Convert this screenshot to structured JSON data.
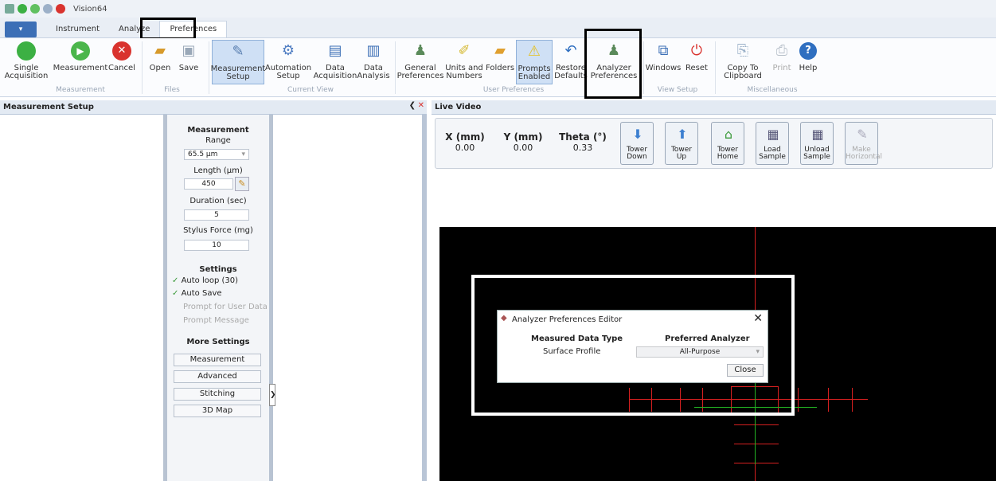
{
  "app": {
    "title": "Vision64"
  },
  "tabs": [
    "Instrument",
    "Analyze",
    "Preferences"
  ],
  "ribbon": {
    "buttons": [
      {
        "label": "Single\nAcquisition",
        "icon": "play-green-circle-icon"
      },
      {
        "label": "Measurement",
        "icon": "play-triangle-icon"
      },
      {
        "label": "Cancel",
        "icon": "cancel-x-icon"
      },
      {
        "label": "Open",
        "icon": "open-folder-icon"
      },
      {
        "label": "Save",
        "icon": "save-icon"
      },
      {
        "label": "Measurement\nSetup",
        "icon": "measurement-setup-icon"
      },
      {
        "label": "Automation\nSetup",
        "icon": "automation-setup-icon"
      },
      {
        "label": "Data\nAcquisition",
        "icon": "data-acquisition-icon"
      },
      {
        "label": "Data\nAnalysis",
        "icon": "data-analysis-icon"
      },
      {
        "label": "General\nPreferences",
        "icon": "general-preferences-icon"
      },
      {
        "label": "Units and\nNumbers",
        "icon": "ruler-icon"
      },
      {
        "label": "Folders",
        "icon": "folders-icon"
      },
      {
        "label": "Prompts\nEnabled",
        "icon": "prompts-warning-icon"
      },
      {
        "label": "Restore\nDefaults",
        "icon": "undo-arrow-icon"
      },
      {
        "label": "Analyzer\nPreferences",
        "icon": "analyzer-preferences-icon"
      },
      {
        "label": "Windows",
        "icon": "windows-icon"
      },
      {
        "label": "Reset",
        "icon": "reset-power-icon"
      },
      {
        "label": "Copy To\nClipboard",
        "icon": "copy-clipboard-icon"
      },
      {
        "label": "Print",
        "icon": "printer-icon"
      },
      {
        "label": "Help",
        "icon": "help-icon"
      }
    ],
    "groups": [
      "Measurement",
      "Files",
      "Current View",
      "User Preferences",
      "View Setup",
      "Miscellaneous"
    ]
  },
  "measurement_setup": {
    "header": "Measurement Setup",
    "measurement_title": "Measurement",
    "range_label": "Range",
    "range_value": "65.5 µm",
    "length_label": "Length (µm)",
    "length_value": "450",
    "duration_label": "Duration (sec)",
    "duration_value": "5",
    "stylus_label": "Stylus Force (mg)",
    "stylus_value": "10",
    "settings_title": "Settings",
    "settings": [
      "Auto loop (30)",
      "Auto Save",
      "Prompt for User Data",
      "Prompt Message"
    ],
    "more_title": "More Settings",
    "more_buttons": [
      "Measurement",
      "Advanced",
      "Stitching",
      "3D Map"
    ]
  },
  "live_video": {
    "header": "Live Video",
    "coords": [
      {
        "label": "X (mm)",
        "value": "0.00"
      },
      {
        "label": "Y (mm)",
        "value": "0.00"
      },
      {
        "label": "Theta (°)",
        "value": "0.33"
      }
    ],
    "tower_buttons": [
      "Tower\nDown",
      "Tower\nUp",
      "Tower\nHome",
      "Load\nSample",
      "Unload\nSample",
      "Make\nHorizontal"
    ]
  },
  "dialog": {
    "title": "Analyzer Preferences Editor",
    "col1": "Measured Data Type",
    "col2": "Preferred Analyzer",
    "row_type": "Surface Profile",
    "row_analyzer": "All-Purpose",
    "close": "Close"
  },
  "colors": {
    "accent": "#3c6fb6",
    "panel": "#e3eaf3",
    "crosshair_red": "#d62020",
    "crosshair_green": "#23b323"
  }
}
